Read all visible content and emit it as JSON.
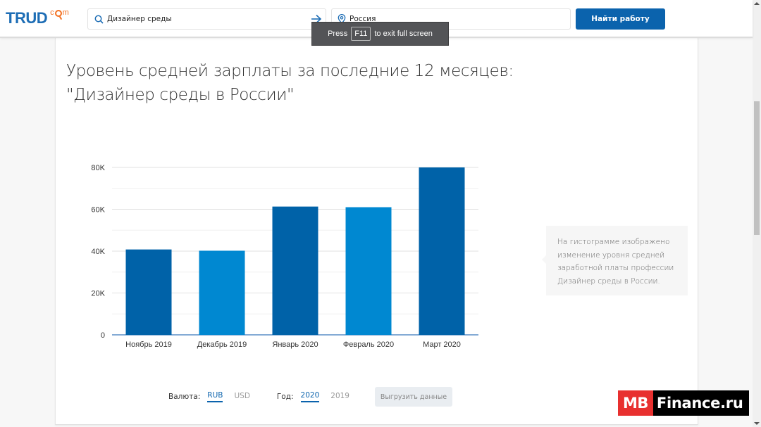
{
  "header": {
    "logo_main": "TRUD",
    "logo_sub_left": "c",
    "logo_sub_right": "m",
    "search_value": "Дизайнер среды",
    "location_value": "Россия",
    "find_button": "Найти работу",
    "icons": {
      "search": "search-icon",
      "arrow": "arrow-right-icon",
      "location": "location-pin-icon"
    }
  },
  "fullscreen_toast": {
    "press": "Press",
    "key": "F11",
    "rest": "to exit full screen"
  },
  "page": {
    "title_line1": "Уровень средней зарплаты за последние 12 месяцев:",
    "title_line2": "\"Дизайнер среды в России\"",
    "info_text": "На гистограмме изображено изменение уровня средней заработной платы профессии Дизайнер среды в России."
  },
  "controls": {
    "currency_label": "Валюта:",
    "currency_options": [
      "RUB",
      "USD"
    ],
    "currency_selected": "RUB",
    "year_label": "Год:",
    "year_options": [
      "2020",
      "2019"
    ],
    "year_selected": "2020",
    "export_button": "Выгрузить данные"
  },
  "watermark": {
    "part1": "MB",
    "part2": "Finance.ru"
  },
  "colors": {
    "accent": "#0b63ad",
    "bar_dark": "#0062a8",
    "bar_light": "#0088d1",
    "watermark_red": "#e8302f"
  },
  "chart_data": {
    "type": "bar",
    "title": "",
    "xlabel": "",
    "ylabel": "",
    "categories": [
      "Ноябрь 2019",
      "Декабрь 2019",
      "Январь 2020",
      "Февраль 2020",
      "Март 2020"
    ],
    "values": [
      40800,
      40200,
      61300,
      61000,
      80000
    ],
    "bar_colors": [
      "#0062a8",
      "#0088d1",
      "#0062a8",
      "#0088d1",
      "#0062a8"
    ],
    "ylim": [
      0,
      80000
    ],
    "yticks": [
      0,
      20000,
      40000,
      60000,
      80000
    ],
    "ytick_labels": [
      "0",
      "20K",
      "40K",
      "60K",
      "80K"
    ],
    "minor_gridlines": [
      10000,
      30000,
      50000,
      70000
    ],
    "grid": true,
    "legend": "none"
  }
}
